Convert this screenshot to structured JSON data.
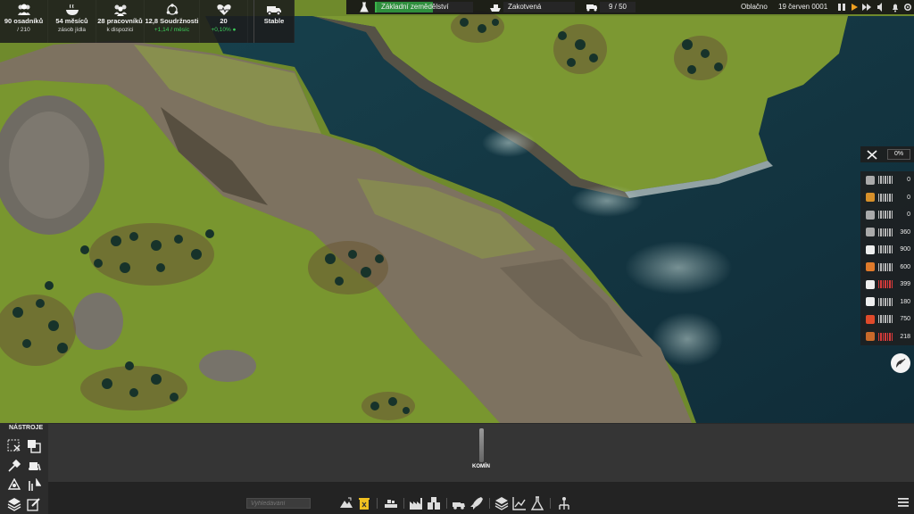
{
  "stats": [
    {
      "icon": "settlers-icon",
      "value": "90 osadníků",
      "sub": "/ 210",
      "sub_color": "#dcdcdc"
    },
    {
      "icon": "food-bowl-icon",
      "value": "54 měsíců",
      "sub": "zásob jídla",
      "sub_color": "#dcdcdc"
    },
    {
      "icon": "workers-icon",
      "value": "28 pracovníků",
      "sub": "k dispozici",
      "sub_color": "#dcdcdc"
    },
    {
      "icon": "unity-icon",
      "value": "12,8 Soudržnosti",
      "sub": "+1,14 / měsíc",
      "sub_color": "#3dd05a"
    },
    {
      "icon": "health-icon",
      "value": "20",
      "sub": "+0,10%",
      "sub_color": "#3dd05a"
    },
    {
      "icon": "truck-stable-icon",
      "value": "Stable",
      "sub": "",
      "sub_color": "#dcdcdc"
    }
  ],
  "topbar": {
    "edict": "Základní zemědělství",
    "edict_progress": 0.58,
    "ship": "Zakotvená",
    "trucks": "9 / 50",
    "weather": "Oblačno",
    "date": "19 červen 0001"
  },
  "maintenance": {
    "label": "0%"
  },
  "resources": [
    {
      "icon": "maintenance-icon",
      "value": "0",
      "bar": "gray"
    },
    {
      "icon": "ore-icon",
      "value": "0",
      "bar": "gray"
    },
    {
      "icon": "crate-icon",
      "value": "0",
      "bar": "gray"
    },
    {
      "icon": "plate-icon",
      "value": "360",
      "bar": "gray"
    },
    {
      "icon": "box-icon",
      "value": "900",
      "bar": "gray"
    },
    {
      "icon": "food-jar-icon",
      "value": "600",
      "bar": "gray"
    },
    {
      "icon": "coal-icon",
      "value": "399",
      "bar": "red"
    },
    {
      "icon": "wrench-part-icon",
      "value": "180",
      "bar": "gray"
    },
    {
      "icon": "fuel-icon",
      "value": "750",
      "bar": "gray"
    },
    {
      "icon": "wood-icon",
      "value": "218",
      "bar": "red"
    }
  ],
  "tools": {
    "title": "NÁSTROJE"
  },
  "chimney": {
    "label": "KOMÍN"
  },
  "search": {
    "placeholder": "Vyhledávání"
  },
  "colors": {
    "edict": "#2e8f3d",
    "warning": "#d63a3a",
    "panel": "#353535"
  }
}
